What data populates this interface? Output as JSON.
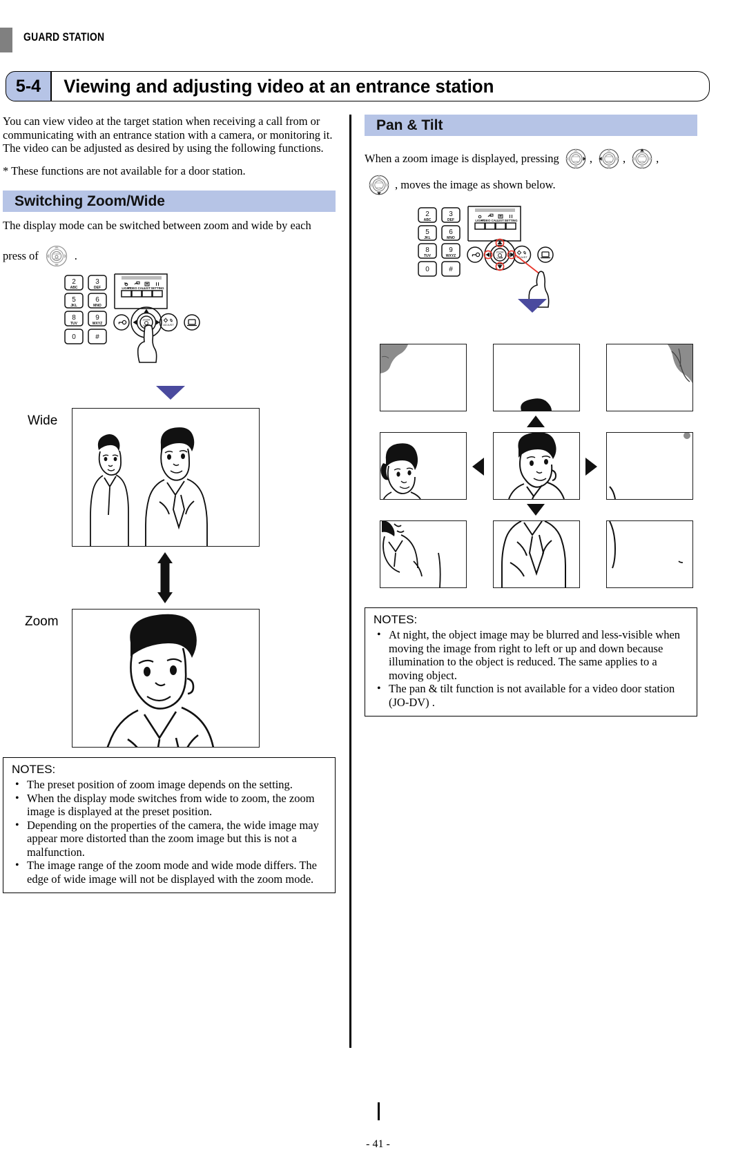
{
  "runhead": {
    "label": "GUARD STATION"
  },
  "title": {
    "number": "5-4",
    "heading": "Viewing and adjusting video at an entrance station"
  },
  "intro": {
    "paragraph": "You can view video at the target station when receiving a call from or communicating with an entrance station with a camera, or monitoring it. The video can be adjusted as desired by using the following functions.",
    "footnote": "* These functions are not available for a door station."
  },
  "sections": {
    "zoom_wide": {
      "band": "Switching Zoom/Wide",
      "lead_before": "The display mode can be switched between zoom and wide by each",
      "lead_press": "press of",
      "lead_after": ".",
      "label_wide": "Wide",
      "label_zoom": "Zoom"
    },
    "pan_tilt": {
      "band": "Pan & Tilt",
      "lead_before": "When a zoom image is displayed, pressing",
      "lead_after": ", moves the image as shown below.",
      "comma": ",",
      "icons": [
        "dpad-right-icon",
        "dpad-left-icon",
        "dpad-up-icon",
        "dpad-down-icon"
      ]
    }
  },
  "keypad": {
    "keys": [
      {
        "digit": "2",
        "letters": "ABC"
      },
      {
        "digit": "3",
        "letters": "DEF"
      },
      {
        "digit": "5",
        "letters": "JKL"
      },
      {
        "digit": "6",
        "letters": "MNO"
      },
      {
        "digit": "8",
        "letters": "TUV"
      },
      {
        "digit": "9",
        "letters": "WXYZ"
      },
      {
        "digit": "0",
        "letters": ""
      },
      {
        "digit": "#",
        "letters": ""
      }
    ],
    "softkeys": [
      "LIGHT",
      "VIDEO CALL",
      "LIST",
      "SETTING"
    ],
    "center_button": {
      "line1": "ZOOM",
      "line2": "WIDE"
    },
    "adjust_button": "ADJUST"
  },
  "notes_left": {
    "title": "NOTES:",
    "items": [
      "The preset position of zoom image depends on the setting.",
      "When the display mode switches from wide to zoom, the zoom image is displayed at the preset position.",
      "Depending on the properties of the camera, the wide image may appear more distorted than the zoom image but this is not a malfunction.",
      "The image range of the zoom mode and wide mode differs. The edge of wide image will not be displayed with the zoom mode."
    ]
  },
  "notes_right": {
    "title": "NOTES:",
    "items": [
      "At night, the object image may be blurred and less-visible when moving the image from right to left or up and down because illumination to the object is reduced. The same applies to a moving object.",
      "The pan & tilt function is not available for a video door station (JO-DV) ."
    ]
  },
  "colors": {
    "band": "#b6c4e6",
    "badge": "#b6c4e6",
    "blue_triangle": "#4a4a9e",
    "highlight_red": "#e8352a",
    "runhead_mark": "#808080"
  },
  "footer": {
    "page": "- 41 -"
  }
}
